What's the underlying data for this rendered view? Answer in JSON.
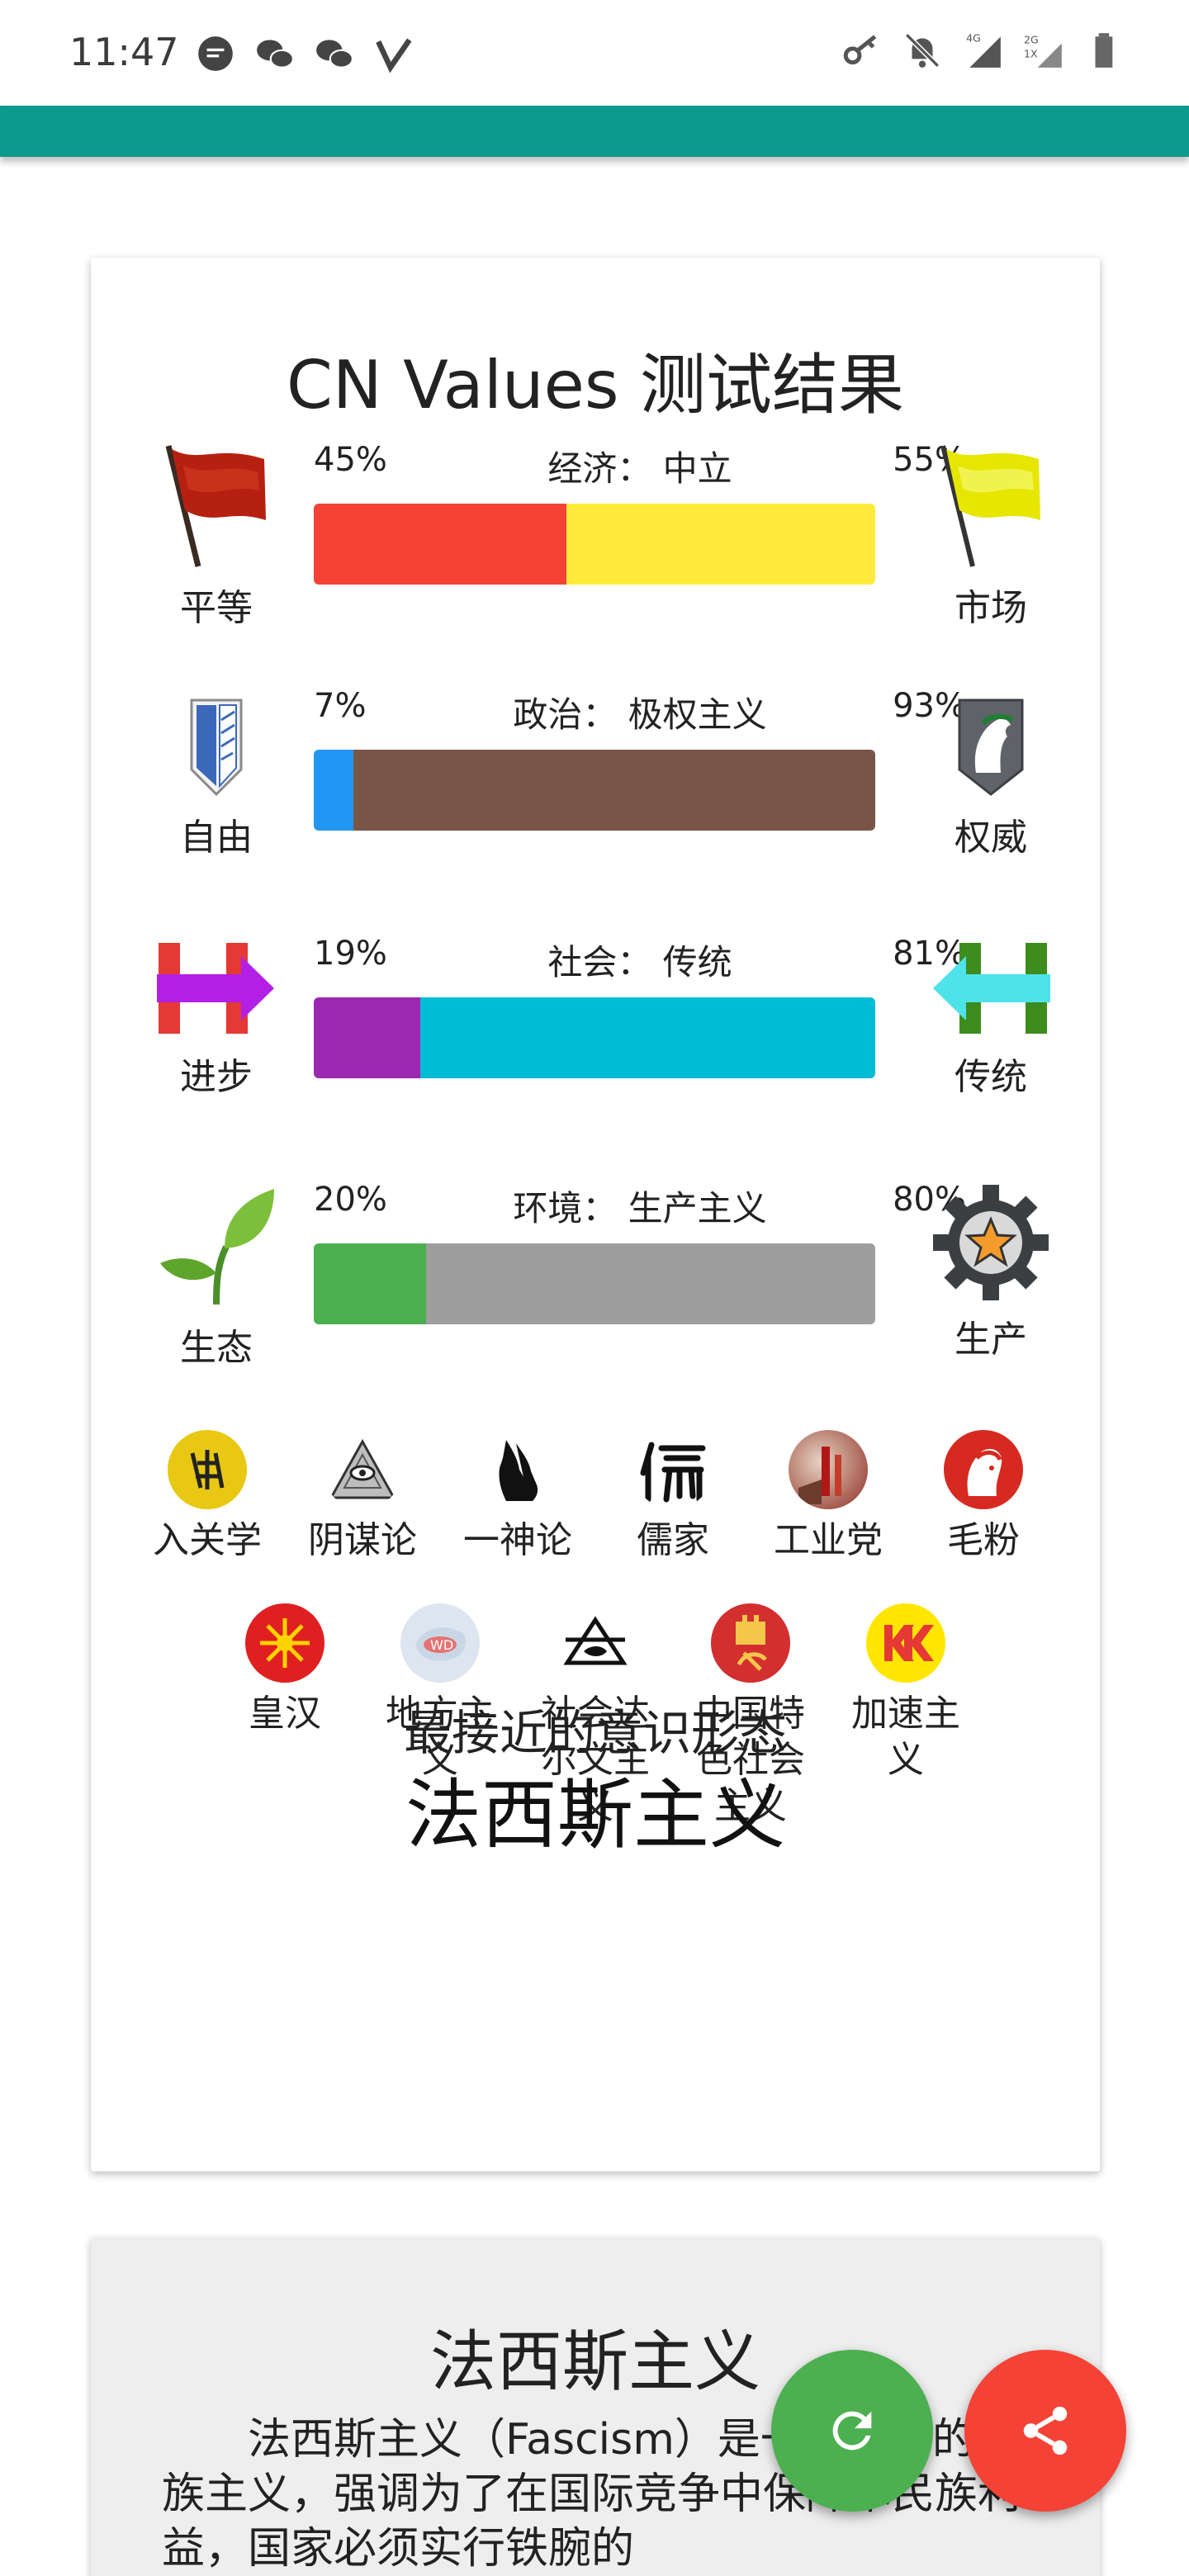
{
  "status_bar": {
    "time": "11:47"
  },
  "result": {
    "title": "CN Values 测试结果",
    "axes": [
      {
        "left_label": "平等",
        "right_label": "市场",
        "left_pct": "45%",
        "right_pct": "55%",
        "axis_text": "经济：  中立",
        "left_value": 45,
        "left_color": "#f44336",
        "right_color": "#ffeb3b",
        "left_icon": "red-flag-icon",
        "right_icon": "yellow-flag-icon"
      },
      {
        "left_label": "自由",
        "right_label": "权威",
        "left_pct": "7%",
        "right_pct": "93%",
        "axis_text": "政治：  极权主义",
        "left_value": 7,
        "left_color": "#2196f3",
        "right_color": "#795548",
        "left_icon": "wings-emblem-icon",
        "right_icon": "horse-emblem-icon"
      },
      {
        "left_label": "进步",
        "right_label": "传统",
        "left_pct": "19%",
        "right_pct": "81%",
        "axis_text": "社会：  传统",
        "left_value": 19,
        "left_color": "#9c27b0",
        "right_color": "#00bcd4",
        "left_icon": "right-arrow-h-icon",
        "right_icon": "left-arrow-h-icon"
      },
      {
        "left_label": "生态",
        "right_label": "生产",
        "left_pct": "20%",
        "right_pct": "80%",
        "axis_text": "环境：  生产主义",
        "left_value": 20,
        "left_color": "#4caf50",
        "right_color": "#9e9e9e",
        "left_icon": "sprout-icon",
        "right_icon": "gear-star-icon"
      }
    ],
    "tags_row1": [
      {
        "name": "入关学",
        "icon": "yellow-seal-icon"
      },
      {
        "name": "阴谋论",
        "icon": "eye-pyramid-icon"
      },
      {
        "name": "一神论",
        "icon": "praying-hands-icon"
      },
      {
        "name": "儒家",
        "icon": "ru-character-icon"
      },
      {
        "name": "工业党",
        "icon": "industry-painting-icon"
      },
      {
        "name": "毛粉",
        "icon": "red-portrait-icon"
      }
    ],
    "tags_row2": [
      {
        "name": "皇汉",
        "icon": "red-sun-icon"
      },
      {
        "name": "地方主义",
        "icon": "pale-map-icon"
      },
      {
        "name": "社会达尔文主义",
        "icon": "fish-triangle-icon"
      },
      {
        "name": "中国特色社会主义",
        "icon": "hammer-sickle-icon"
      },
      {
        "name": "加速主义",
        "icon": "kk-logo-icon"
      }
    ],
    "closest_label": "最接近的意识形态",
    "closest_value": "法西斯主义"
  },
  "description": {
    "title": "法西斯主义",
    "body": "法西斯主义（Fascism）是一种极端的民族主义，强调为了在国际竞争中保障本民族利益，国家必须实行铁腕的"
  }
}
